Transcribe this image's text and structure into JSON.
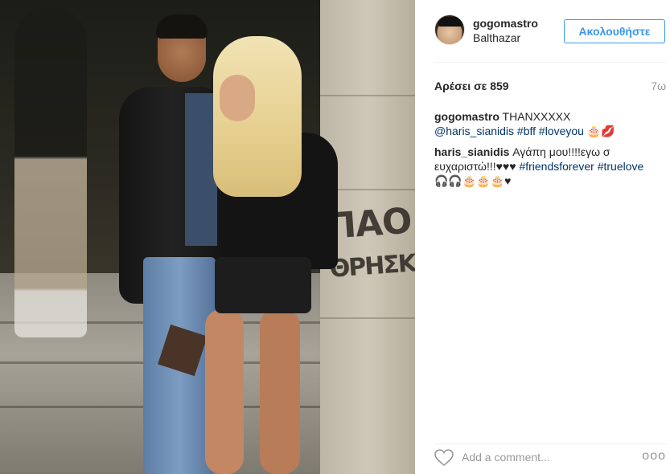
{
  "post": {
    "username": "gogomastro",
    "location": "Balthazar",
    "follow_label": "Ακολουθήστε",
    "likes": "Αρέσει σε 859",
    "time": "7ω",
    "comments": [
      {
        "author": "gogomastro",
        "text": " THANXXXXX",
        "tags": "@haris_sianidis #bff #loveyou",
        "emoji": " 🎂💋"
      },
      {
        "author": "haris_sianidis",
        "text": " Αγάπη μου!!!!εγω σ ευχαριστώ!!!♥♥♥ ",
        "tags": "#friendsforever #truelove",
        "emoji": " 🎧🎧🎂🎂🎂♥"
      }
    ],
    "add_comment_placeholder": "Add a comment...",
    "more_glyph": "ooo",
    "photo_graffiti_line1": "ΠΑΟ",
    "photo_graffiti_line2": "ΘΡΗΣΚ"
  },
  "colors": {
    "accent_blue": "#3897f0",
    "link_blue": "#003569",
    "text_dark": "#262626",
    "text_muted": "#999999"
  },
  "icons": {
    "like": "heart-outline-icon",
    "more": "more-options-icon"
  }
}
